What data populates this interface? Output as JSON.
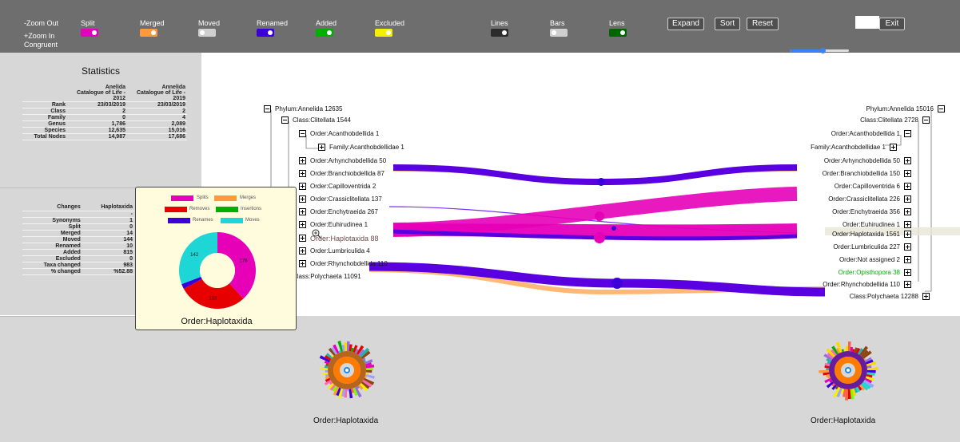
{
  "colors": {
    "split": "#e600b8",
    "merged": "#ff9a3c",
    "moved": "#cfcfcf",
    "renamed": "#3b00d9",
    "added": "#00b000",
    "excluded": "#f5f000",
    "lines": "#2c2c2c",
    "bars": "#cfcfcf",
    "lens": "#006400"
  },
  "topbar": {
    "zoom_out": "-Zoom Out",
    "zoom_in": "+Zoom In",
    "congruent": "Congruent",
    "toggles": [
      {
        "label": "Split"
      },
      {
        "label": "Merged"
      },
      {
        "label": "Moved"
      },
      {
        "label": "Renamed"
      },
      {
        "label": "Added"
      },
      {
        "label": "Excluded"
      },
      {
        "label": "Lines"
      },
      {
        "label": "Bars"
      },
      {
        "label": "Lens"
      }
    ],
    "expand": "Expand",
    "sort": "Sort",
    "reset": "Reset",
    "exit": "Exit",
    "slider_value": 0.55
  },
  "statistics": {
    "title": "Statistics",
    "col1": [
      "Anelida",
      "Catalogue of Life -",
      "2012"
    ],
    "col2": [
      "Annelida",
      "Catalogue of Life -",
      "2019"
    ],
    "rows": [
      {
        "label": "Rank",
        "a": "23/03/2019",
        "b": "23/03/2019"
      },
      {
        "label": "Class",
        "a": "2",
        "b": "2"
      },
      {
        "label": "Family",
        "a": "0",
        "b": "4"
      },
      {
        "label": "Genus",
        "a": "1,786",
        "b": "2,089"
      },
      {
        "label": "Species",
        "a": "12,635",
        "b": "15,016"
      },
      {
        "label": "Total Nodes",
        "a": "14,987",
        "b": "17,686"
      }
    ]
  },
  "changes": {
    "header_label": "Changes",
    "header_value": "Haplotaxida",
    "dash": "-",
    "rows": [
      {
        "label": "Synonyms",
        "value": "1"
      },
      {
        "label": "Split",
        "value": "0"
      },
      {
        "label": "Merged",
        "value": "14"
      },
      {
        "label": "Moved",
        "value": "144"
      },
      {
        "label": "Renamed",
        "value": "10"
      },
      {
        "label": "Added",
        "value": "815"
      },
      {
        "label": "Excluded",
        "value": "0"
      },
      {
        "label": "Taxa changed",
        "value": "983"
      },
      {
        "label": "% changed",
        "value": "%52.88"
      }
    ]
  },
  "tooltip": {
    "legend": [
      "Splits",
      "Merges",
      "Removes",
      "Insertions",
      "Renames",
      "Moves"
    ],
    "donut": [
      {
        "name": "Splits",
        "value": 176,
        "color": "#e600b8"
      },
      {
        "name": "Removes",
        "value": 133,
        "color": "#e60000"
      },
      {
        "name": "Renames",
        "value": 10,
        "color": "#3b00d9"
      },
      {
        "name": "Moves",
        "value": 142,
        "color": "#1fd6d6"
      }
    ],
    "title": "Order:Haplotaxida"
  },
  "left_tree": [
    "Phylum:Annelida 12635",
    "Class:Clitellata 1544",
    "Order:Acanthobdellida 1",
    "Family:Acanthobdellidae 1",
    "Order:Arhynchobdellida 50",
    "Order:Branchiobdellida 87",
    "Order:Capilloventrida 2",
    "Order:Crassiclitellata 137",
    "Order:Enchytraeida 267",
    "Order:Euhirudinea 1",
    "Order:Haplotaxida 88",
    "Order:Lumbriculida 4",
    "Order:Rhynchobdellida 110",
    "Class:Polychaeta 11091"
  ],
  "right_tree": [
    "Phylum:Annelida 15016",
    "Class:Clitellata 2728",
    "Order:Acanthobdellida 1",
    "Family:Acanthobdellidae 1",
    "Order:Arhynchobdellida 50",
    "Order:Branchiobdellida 150",
    "Order:Capilloventrida 6",
    "Order:Crassiclitellata 226",
    "Order:Enchytraeida 356",
    "Order:Euhirudinea 1",
    "Order:Haplotaxida 1561",
    "Order:Lumbriculida 227",
    "Order:Not assigned 2",
    "Order:Opisthopora 38",
    "Order:Rhynchobdellida 110",
    "Class:Polychaeta 12288"
  ],
  "bottom": {
    "left_label": "Order:Haplotaxida",
    "right_label": "Order:Haplotaxida"
  }
}
